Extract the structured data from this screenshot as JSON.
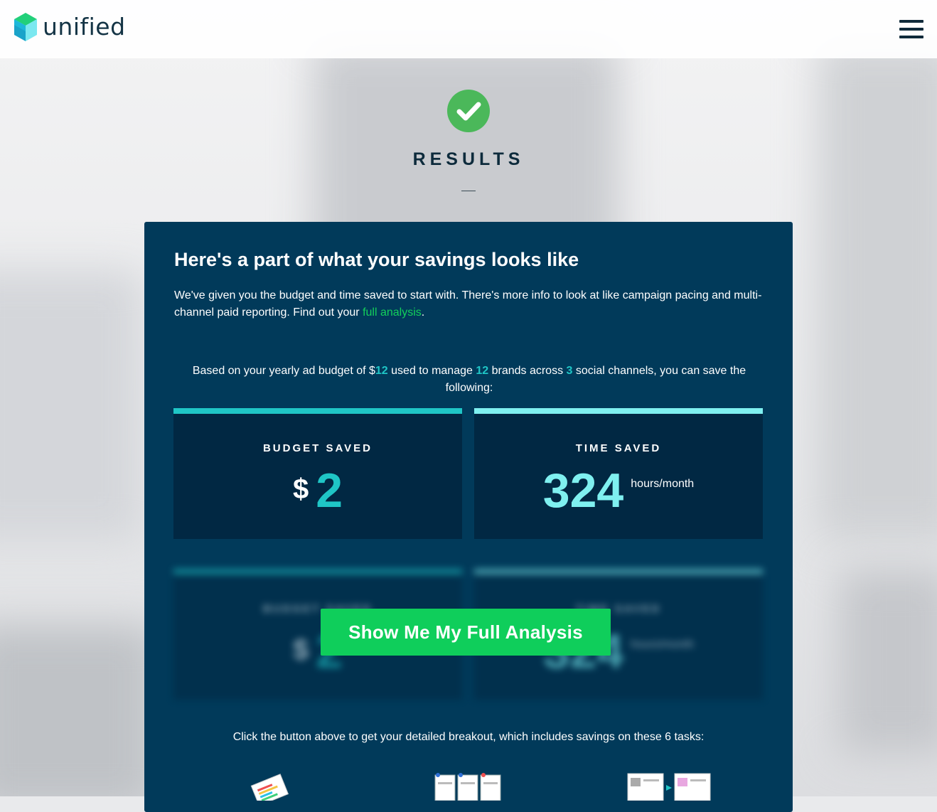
{
  "header": {
    "logo_text": "unified",
    "menu_icon": "hamburger-menu-icon"
  },
  "hero": {
    "status_icon": "check-circle-icon",
    "title": "RESULTS"
  },
  "panel": {
    "heading": "Here's a part of what your savings looks like",
    "intro_text": "We've given you the budget and time saved to start with. There's more info to look at like campaign pacing and multi-channel paid reporting. Find out your ",
    "intro_link": "full analysis",
    "intro_end": ".",
    "basis": {
      "part1": "Based on your yearly ad budget of $",
      "budget": "12",
      "part2": " used to manage ",
      "brands": "12",
      "part3": " brands across ",
      "channels": "3",
      "part4": " social channels, you can save the following:"
    },
    "budget_card": {
      "label": "BUDGET SAVED",
      "currency": "$",
      "value": "2"
    },
    "time_card": {
      "label": "TIME SAVED",
      "value": "324",
      "unit": "hours/month"
    },
    "cta_label": "Show Me My Full Analysis",
    "tasks_text": "Click the button above to get your detailed breakout, which includes savings on these 6 tasks:",
    "task_icons": [
      "report-card-icon",
      "calendar-grid-icon",
      "layout-preview-icon"
    ]
  },
  "colors": {
    "panel": "#013a5a",
    "card": "#012843",
    "teal": "#1fc6c6",
    "light_teal": "#7ff0f0",
    "green": "#0fce5b",
    "check": "#4bb85a"
  }
}
